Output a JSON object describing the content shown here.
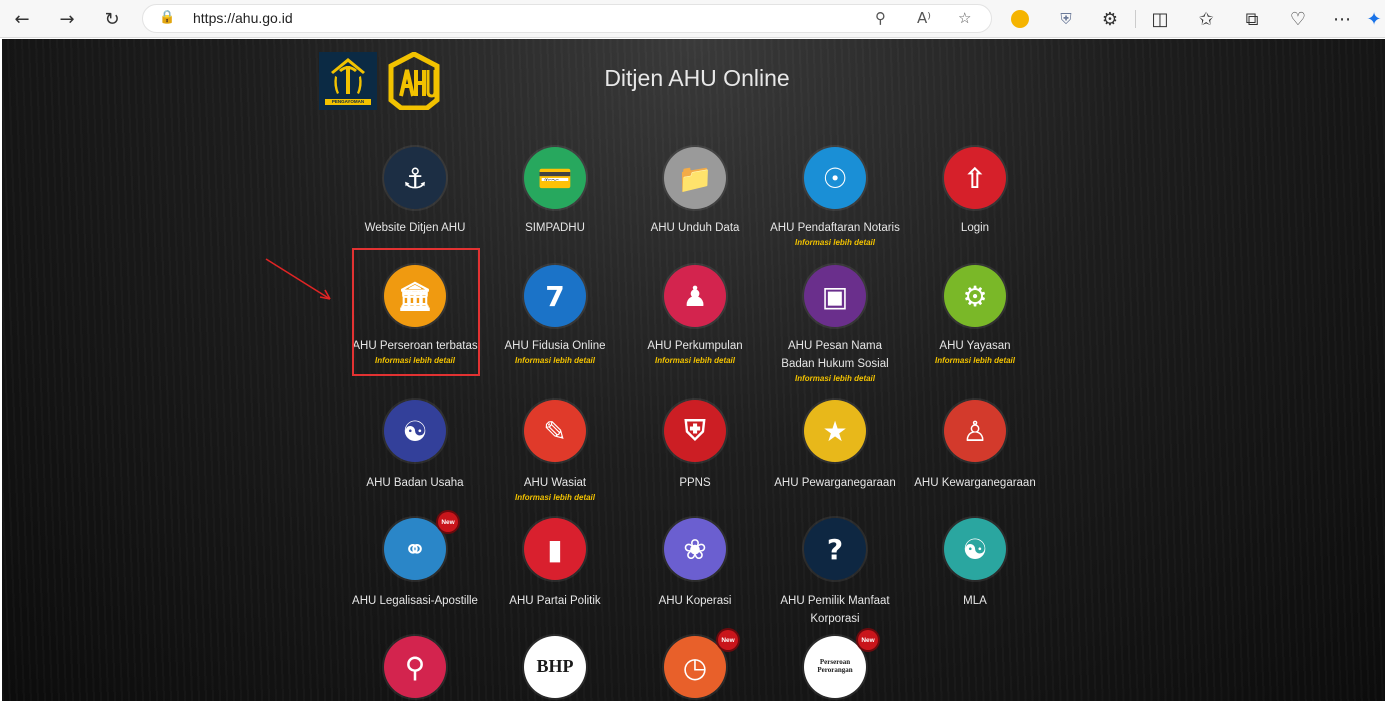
{
  "browser": {
    "url": "https://ahu.go.id",
    "icons": [
      "back-icon",
      "forward-icon",
      "refresh-icon",
      "lock-icon",
      "zoom-icon",
      "read-aloud-icon",
      "favorite-icon",
      "emoji-extension-icon",
      "shield-extension-icon",
      "extensions-icon",
      "split-screen-icon",
      "favorites-icon",
      "collections-icon",
      "health-icon",
      "more-icon",
      "copilot-icon"
    ]
  },
  "site": {
    "title": "Ditjen AHU Online",
    "logo1_text": "PENGAYOMAN"
  },
  "info_label": "Informasi lebih detail",
  "new_label": "New",
  "tiles": [
    {
      "label": "Website Ditjen AHU",
      "info": false,
      "color": "#1c2e44",
      "icon": "pengayoman-icon"
    },
    {
      "label": "SIMPADHU",
      "info": false,
      "color": "#27a85e",
      "icon": "money-card-icon"
    },
    {
      "label": "AHU Unduh Data",
      "info": false,
      "color": "#9a9a9a",
      "icon": "folder-search-icon"
    },
    {
      "label": "AHU Pendaftaran Notaris",
      "info": true,
      "color": "#1a8fd6",
      "icon": "network-house-icon"
    },
    {
      "label": "Login",
      "info": false,
      "color": "#d6202a",
      "icon": "login-icon"
    },
    {
      "label": "AHU Perseroan terbatas",
      "info": true,
      "color": "#f09a10",
      "icon": "building-bank-icon"
    },
    {
      "label": "AHU Fidusia Online",
      "info": true,
      "color": "#1b73c8",
      "icon": "seven-minute-icon"
    },
    {
      "label": "AHU Perkumpulan",
      "info": true,
      "color": "#d3244e",
      "icon": "people-group-icon"
    },
    {
      "label": "AHU Pesan Nama Badan Hukum Sosial",
      "info": true,
      "color": "#6a2f8c",
      "icon": "id-card-icon"
    },
    {
      "label": "AHU Yayasan",
      "info": true,
      "color": "#7ab828",
      "icon": "gear-people-icon"
    },
    {
      "label": "AHU Badan Usaha",
      "info": false,
      "color": "#33409a",
      "icon": "handshake-gear-icon"
    },
    {
      "label": "AHU Wasiat",
      "info": true,
      "color": "#e03a2a",
      "icon": "scroll-icon"
    },
    {
      "label": "PPNS",
      "info": false,
      "color": "#cc1e24",
      "icon": "police-badge-icon"
    },
    {
      "label": "AHU Pewarganegaraan",
      "info": false,
      "color": "#e8b81a",
      "icon": "garuda-icon"
    },
    {
      "label": "AHU Kewarganegaraan",
      "info": false,
      "color": "#d33a2c",
      "icon": "person-flag-icon"
    },
    {
      "label": "AHU Legalisasi-Apostille",
      "info": false,
      "new": true,
      "color": "#2a86c8",
      "icon": "globe-document-icon"
    },
    {
      "label": "AHU Partai Politik",
      "info": false,
      "color": "#d9202e",
      "icon": "podium-icon"
    },
    {
      "label": "AHU Koperasi",
      "info": false,
      "color": "#6b5fd0",
      "icon": "cooperative-icon"
    },
    {
      "label": "AHU Pemilik Manfaat Korporasi",
      "info": false,
      "color": "#0e2742",
      "icon": "question-head-icon"
    },
    {
      "label": "MLA",
      "info": false,
      "color": "#2aa6a0",
      "icon": "handshake-globe-icon"
    },
    {
      "label": "",
      "info": false,
      "color": "#d3244e",
      "icon": "search-book-icon"
    },
    {
      "label": "",
      "info": false,
      "color": "#ffffff",
      "icon": "bhp-icon",
      "text": "BHP"
    },
    {
      "label": "",
      "info": false,
      "new": true,
      "color": "#e8602a",
      "icon": "clock-document-icon"
    },
    {
      "label": "",
      "info": false,
      "new": true,
      "color": "#ffffff",
      "icon": "perseroan-perorangan-icon",
      "text": "Perseroan Perorangan"
    }
  ]
}
